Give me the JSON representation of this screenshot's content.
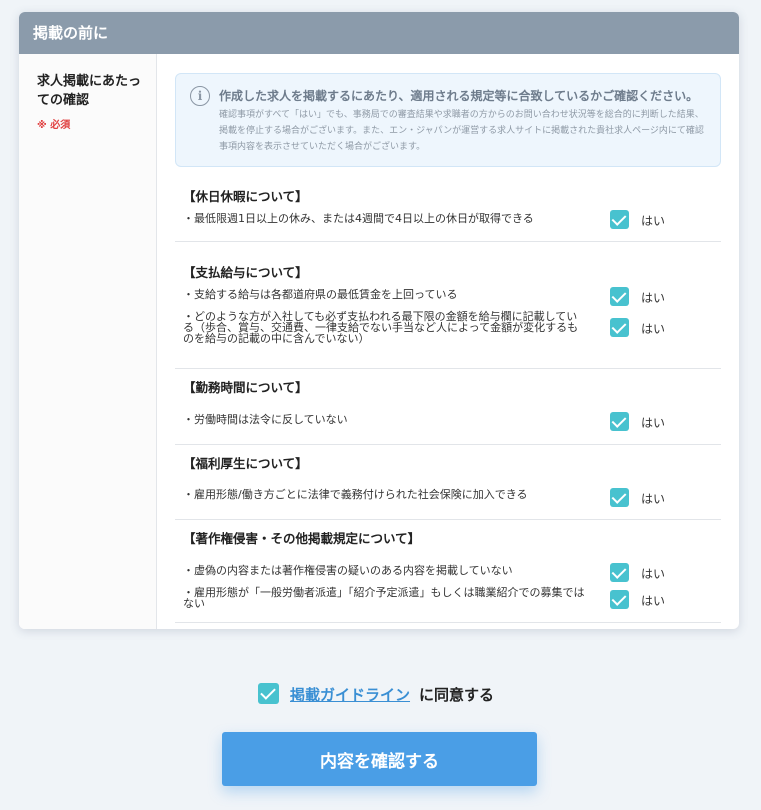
{
  "card": {
    "title": "掲載の前に",
    "left_label": "求人掲載にあたっての確認",
    "required_label": "※ 必須"
  },
  "notice": {
    "icon": "info-icon",
    "title": "作成した求人を掲載するにあたり、適用される規定等に合致しているかご確認ください。",
    "body": "確認事項がすべて「はい」でも、事務局での審査結果や求職者の方からのお問い合わせ状況等を総合的に判断した結果、掲載を停止する場合がございます。また、エン・ジャパンが運営する求人サイトに掲載された貴社求人ページ内にて確認事項内容を表示させていただく場合がございます。"
  },
  "sections": [
    {
      "title": "【休日休暇について】",
      "items": [
        {
          "text": "・最低限週1日以上の休み、または4週間で4日以上の休日が取得できる",
          "checked": true,
          "yes_label": "はい"
        }
      ]
    },
    {
      "title": "【支払給与について】",
      "items": [
        {
          "text": "・支給する給与は各都道府県の最低賃金を上回っている",
          "checked": true,
          "yes_label": "はい"
        },
        {
          "text": "・どのような方が入社しても必ず支払われる最下限の金額を給与欄に記載している（歩合、賞与、交通費、一律支給でない手当など人によって金額が変化するものを給与の記載の中に含んでいない）",
          "checked": true,
          "yes_label": "はい"
        }
      ]
    },
    {
      "title": "【勤務時間について】",
      "items": [
        {
          "text": "・労働時間は法令に反していない",
          "checked": true,
          "yes_label": "はい"
        }
      ]
    },
    {
      "title": "【福利厚生について】",
      "items": [
        {
          "text": "・雇用形態/働き方ごとに法律で義務付けられた社会保険に加入できる",
          "checked": true,
          "yes_label": "はい"
        }
      ]
    },
    {
      "title": "【著作権侵害・その他掲載規定について】",
      "items": [
        {
          "text": "・虚偽の内容または著作権侵害の疑いのある内容を掲載していない",
          "checked": true,
          "yes_label": "はい"
        },
        {
          "text": "・雇用形態が「一般労働者派遣」「紹介予定派遣」もしくは職業紹介での募集ではない",
          "checked": true,
          "yes_label": "はい"
        }
      ]
    }
  ],
  "agreement": {
    "checked": true,
    "link_text": "掲載ガイドライン",
    "suffix_text": "に同意する"
  },
  "confirm_button": {
    "label": "内容を確認する"
  },
  "colors": {
    "header_bg": "#8b9bab",
    "checkbox": "#48c2cf",
    "button": "#4a9ee6",
    "link": "#3a8fd4",
    "required": "#e04040"
  }
}
